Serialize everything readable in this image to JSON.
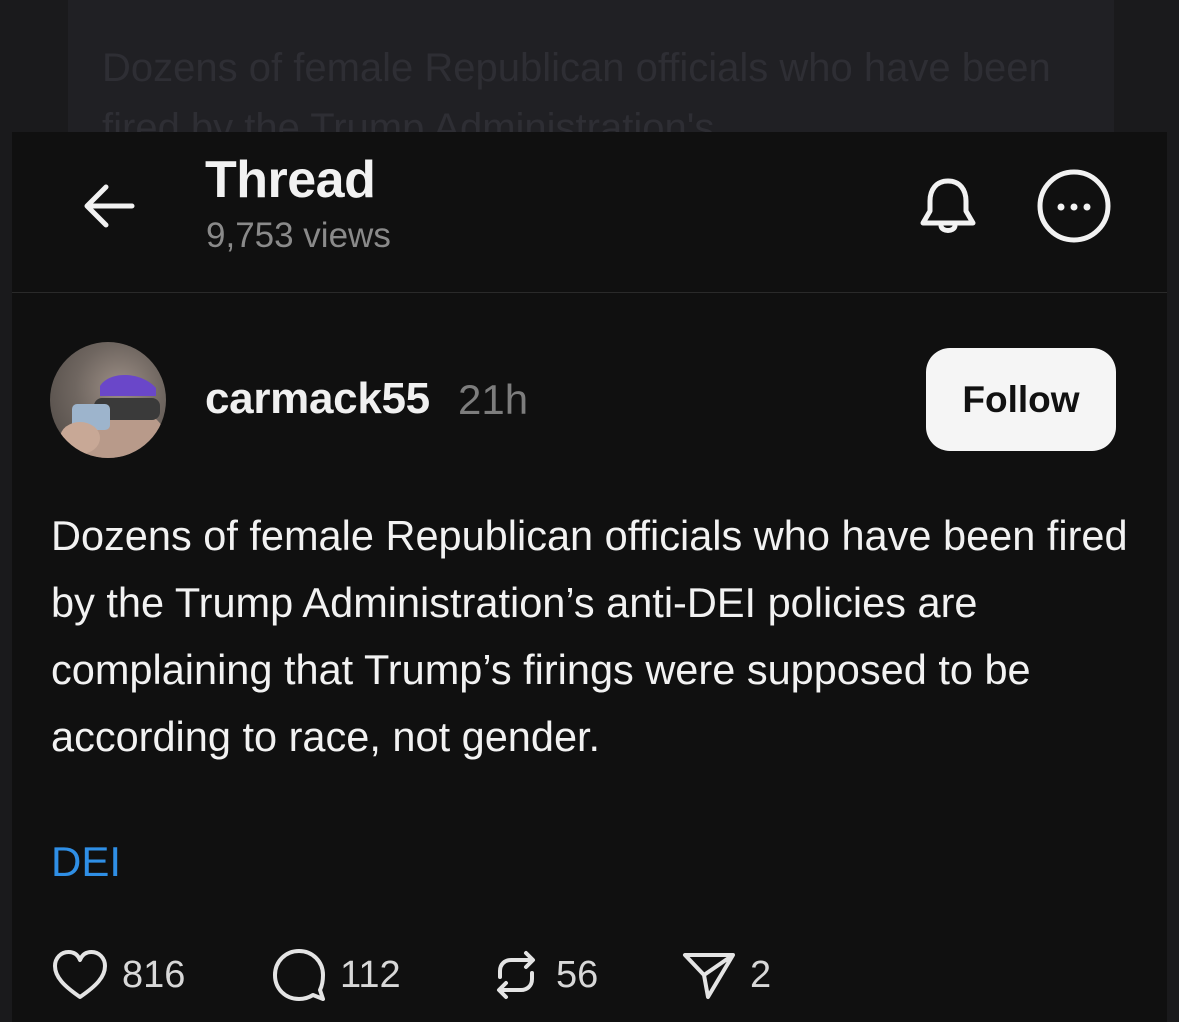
{
  "background_card": {
    "text": "Dozens of female Republican officials who have been fired by the Trump Administration's"
  },
  "header": {
    "title": "Thread",
    "views": "9,753 views"
  },
  "post": {
    "username": "carmack55",
    "time": "21h",
    "follow_label": "Follow",
    "text": "Dozens of female Republican officials who have been fired by the Trump Administration’s anti-DEI policies are complaining that Trump’s firings were supposed to be according to race, not gender.",
    "tag": "DEI"
  },
  "actions": {
    "likes": "816",
    "replies": "112",
    "reposts": "56",
    "shares": "2"
  },
  "colors": {
    "background": "#101010",
    "text": "#f2f2f2",
    "muted": "#8a8a8a",
    "tag": "#2f8fe6",
    "follow_bg": "#f5f5f5"
  },
  "icons": {
    "back": "back-arrow-icon",
    "bell": "bell-icon",
    "more": "more-options-icon",
    "like": "heart-icon",
    "reply": "comment-icon",
    "repost": "repost-icon",
    "share": "send-icon"
  }
}
